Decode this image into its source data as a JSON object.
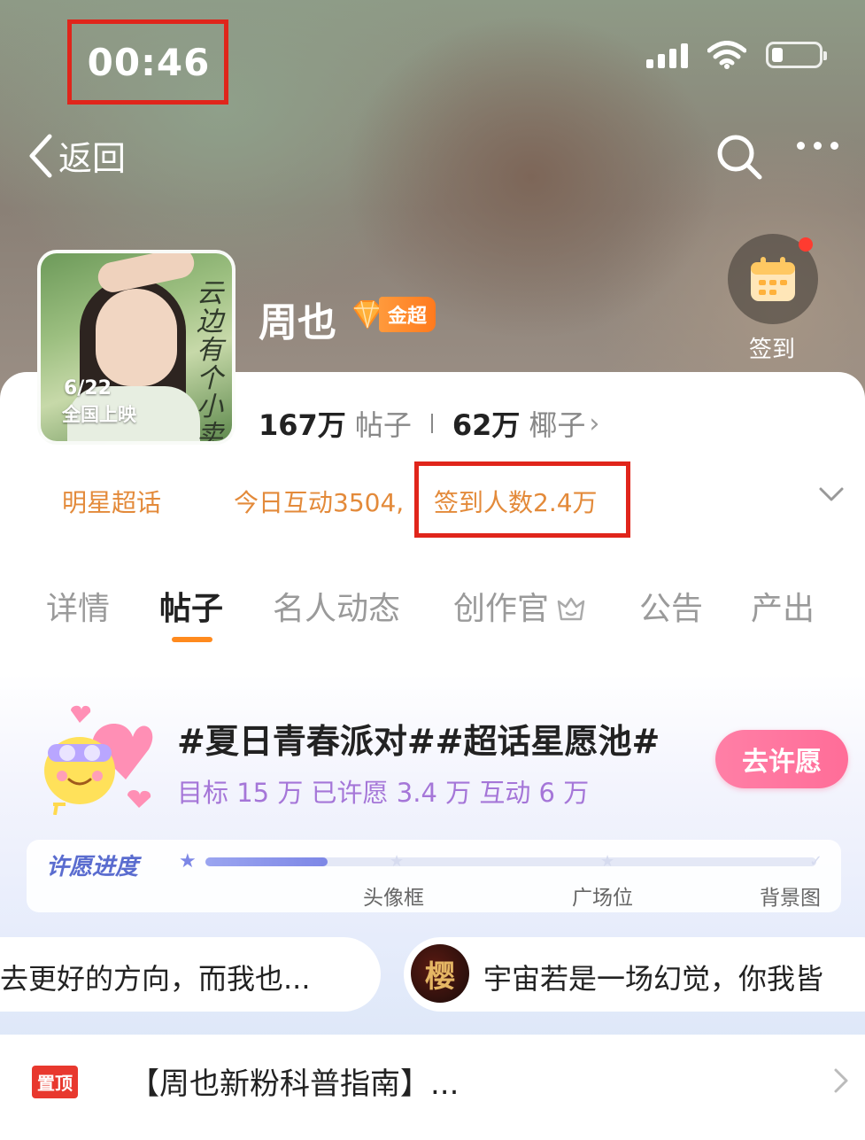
{
  "status_bar": {
    "time": "00:46"
  },
  "nav": {
    "back_label": "返回"
  },
  "topic": {
    "name": "周也",
    "badge": "金超",
    "cover": {
      "date": "6/22",
      "release": "全国上映",
      "film_title": "云边有个小卖部"
    }
  },
  "signin": {
    "label": "签到"
  },
  "stats": {
    "posts_count": "167万",
    "posts_label": "帖子",
    "coconut_count": "62万",
    "coconut_label": "椰子"
  },
  "meta": {
    "category": "明星超话",
    "interaction": "今日互动3504,",
    "signin_count": "签到人数2.4万"
  },
  "tabs": [
    "详情",
    "帖子",
    "名人动态",
    "创作官",
    "公告",
    "产出"
  ],
  "active_tab": "帖子",
  "promo": {
    "title": "#夏日青春派对##超话星愿池#",
    "subtitle": "目标 15 万  已许愿 3.4 万  互动 6 万",
    "button": "去许愿"
  },
  "wish_progress": {
    "title": "许愿进度",
    "milestones": [
      "头像框",
      "广场位",
      "背景图"
    ],
    "progress_fraction": 0.2
  },
  "ticker": {
    "left_text": "去更好的方向，而我也...",
    "avatar_char": "樱",
    "right_text": "宇宙若是一场幻觉，你我皆"
  },
  "pinned": {
    "badge": "置顶",
    "title": "【周也新粉科普指南】..."
  },
  "colors": {
    "accent_orange": "#ff8a1e",
    "highlight_red": "#e0251b",
    "wish_pink": "#ff6d98",
    "progress_blue": "#7d87e6",
    "pin_red": "#e8382e"
  }
}
